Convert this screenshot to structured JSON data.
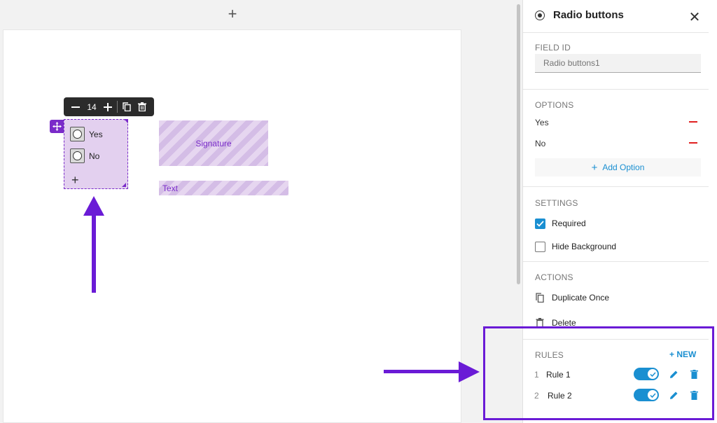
{
  "canvas": {
    "add_page_label": "+",
    "toolbar": {
      "minus": "−",
      "font_size": "14",
      "plus": "+"
    },
    "radio_field": {
      "options": [
        "Yes",
        "No"
      ],
      "add_label": "+"
    },
    "signature_label": "Signature",
    "text_label": "Text"
  },
  "panel": {
    "title": "Radio buttons",
    "title_icon": "radio-icon",
    "close_label": "✕",
    "field_id": {
      "label": "FIELD ID",
      "placeholder": "Radio buttons1"
    },
    "options": {
      "label": "OPTIONS",
      "items": [
        {
          "label": "Yes"
        },
        {
          "label": "No"
        }
      ],
      "add_label": "Add Option"
    },
    "settings": {
      "label": "SETTINGS",
      "required": {
        "label": "Required",
        "checked": true
      },
      "hide_background": {
        "label": "Hide Background",
        "checked": false
      }
    },
    "actions": {
      "label": "ACTIONS",
      "duplicate": "Duplicate Once",
      "delete": "Delete"
    },
    "rules": {
      "label": "RULES",
      "new_label": "+ NEW",
      "items": [
        {
          "num": "1",
          "name": "Rule 1",
          "enabled": true
        },
        {
          "num": "2",
          "name": "Rule 2",
          "enabled": true
        }
      ]
    }
  },
  "colors": {
    "accent": "#1a8fd1",
    "field_purple": "#7a2bc9",
    "annotation": "#6a1bd6",
    "remove_red": "#e02020"
  }
}
